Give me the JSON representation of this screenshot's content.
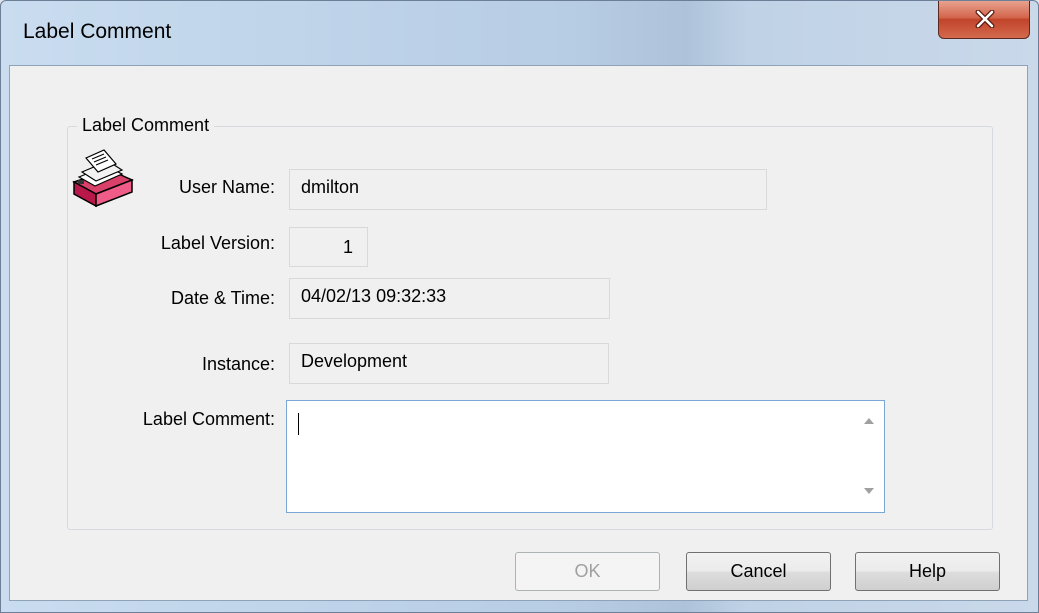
{
  "window": {
    "title": "Label Comment"
  },
  "group": {
    "legend": "Label Comment"
  },
  "fields": {
    "user_name": {
      "label": "User Name:",
      "value": "dmilton"
    },
    "label_version": {
      "label": "Label Version:",
      "value": "1"
    },
    "date_time": {
      "label": "Date & Time:",
      "value": "04/02/13 09:32:33"
    },
    "instance": {
      "label": "Instance:",
      "value": "Development"
    },
    "label_comment": {
      "label": "Label Comment:",
      "value": ""
    }
  },
  "buttons": {
    "ok": "OK",
    "cancel": "Cancel",
    "help": "Help"
  },
  "icons": {
    "close": "close-icon",
    "app": "card-file-icon",
    "scroll_up": "scroll-up-arrow-icon",
    "scroll_down": "scroll-down-arrow-icon"
  }
}
